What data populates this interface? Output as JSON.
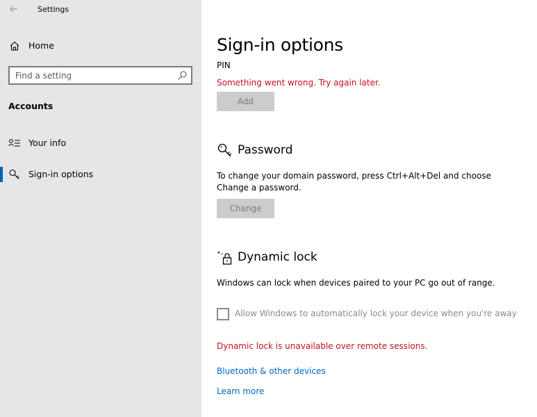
{
  "window": {
    "title": "Settings"
  },
  "sidebar": {
    "home_label": "Home",
    "search": {
      "placeholder": "Find a setting",
      "value": ""
    },
    "section_label": "Accounts",
    "items": [
      {
        "label": "Your info",
        "icon": "person-list-icon",
        "selected": false
      },
      {
        "label": "Sign-in options",
        "icon": "key-icon",
        "selected": true
      }
    ]
  },
  "main": {
    "title": "Sign-in options",
    "pin": {
      "label": "PIN",
      "error": "Something went wrong. Try again later.",
      "button": "Add"
    },
    "password": {
      "heading": "Password",
      "description": "To change your domain password, press Ctrl+Alt+Del and choose Change a password.",
      "button": "Change"
    },
    "dynamic_lock": {
      "heading": "Dynamic lock",
      "description": "Windows can lock when devices paired to your PC go out of range.",
      "checkbox_label": "Allow Windows to automatically lock your device when you're away",
      "checkbox_checked": false,
      "error": "Dynamic lock is unavailable over remote sessions."
    },
    "links": {
      "bluetooth": "Bluetooth & other devices",
      "learn_more": "Learn more"
    }
  },
  "colors": {
    "sidebar_bg": "#e6e6e6",
    "error": "#c50f1f",
    "link": "#0067c0",
    "accent": "#0063b1",
    "disabled_button": "#cccccc"
  }
}
